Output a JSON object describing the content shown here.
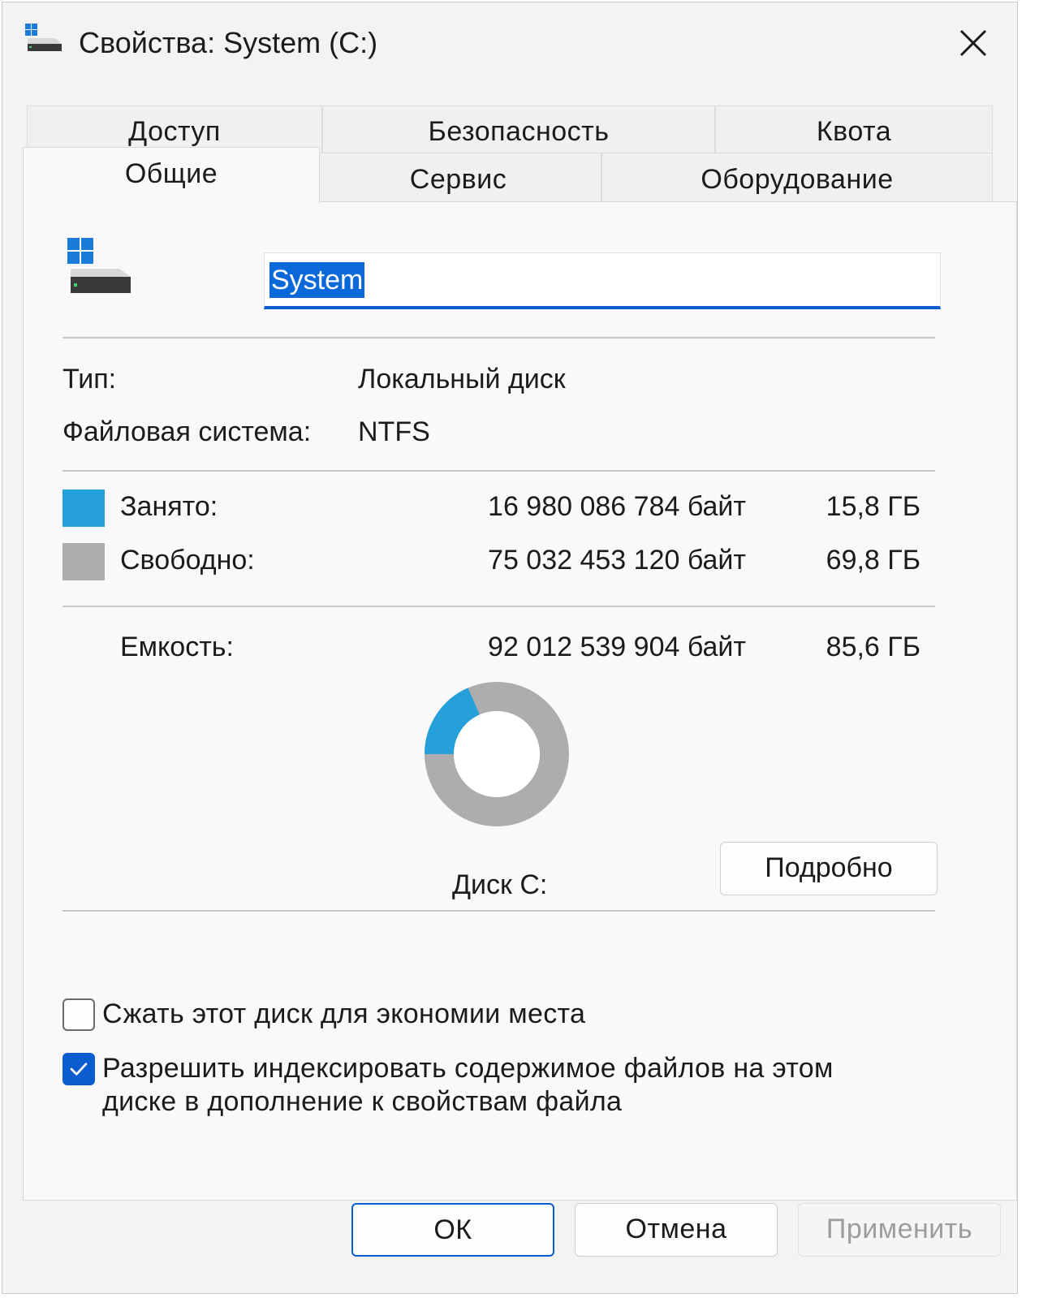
{
  "window": {
    "title": "Свойства: System (C:)",
    "icon": "drive-icon"
  },
  "tabs": {
    "row_back": [
      "Доступ",
      "Безопасность",
      "Квота"
    ],
    "row_mid": [
      "Сервис",
      "Оборудование"
    ],
    "active": "Общие"
  },
  "general": {
    "name_value": "System",
    "type_label": "Тип:",
    "type_value": "Локальный диск",
    "fs_label": "Файловая система:",
    "fs_value": "NTFS",
    "used": {
      "label": "Занято:",
      "bytes": "16 980 086 784 байт",
      "size": "15,8 ГБ",
      "color": "#26a0da"
    },
    "free": {
      "label": "Свободно:",
      "bytes": "75 032 453 120 байт",
      "size": "69,8 ГБ",
      "color": "#adadad"
    },
    "capacity": {
      "label": "Емкость:",
      "bytes": "92 012 539 904 байт",
      "size": "85,6 ГБ"
    },
    "disk_label": "Диск C:",
    "details_button": "Подробно",
    "compress_label": "Сжать этот диск для экономии места",
    "compress_checked": false,
    "index_label_line1": "Разрешить индексировать содержимое файлов на этом",
    "index_label_line2": "диске в дополнение к свойствам файла",
    "index_checked": true
  },
  "footer": {
    "ok": "ОК",
    "cancel": "Отмена",
    "apply": "Применить"
  }
}
